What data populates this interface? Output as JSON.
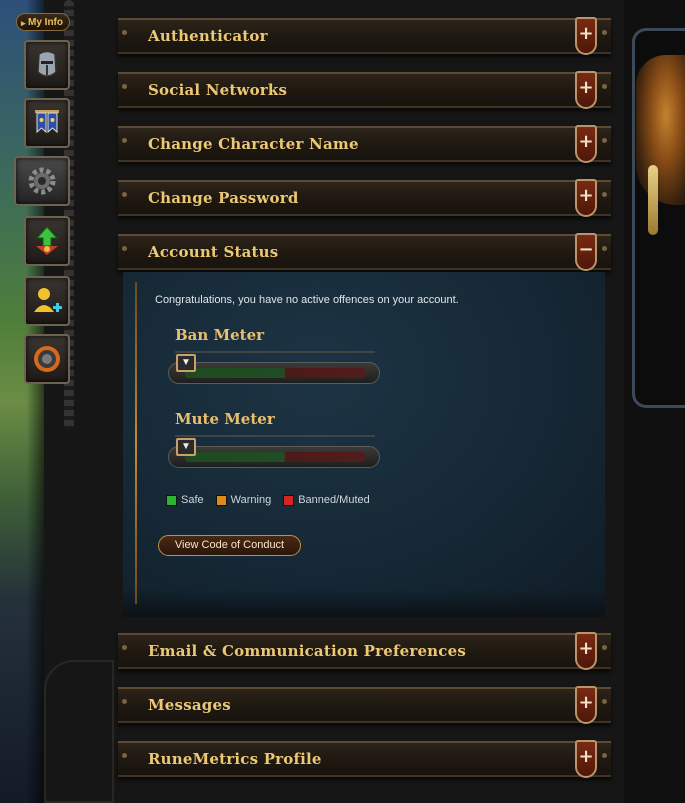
{
  "sidebar": {
    "tab_label": "My Info",
    "buttons": [
      {
        "icon": "helmet-icon"
      },
      {
        "icon": "banner-icon"
      },
      {
        "icon": "gear-icon"
      },
      {
        "icon": "upgrade-icon"
      },
      {
        "icon": "add-user-icon"
      },
      {
        "icon": "bond-icon"
      }
    ]
  },
  "sections": {
    "authenticator": {
      "title": "Authenticator",
      "toggle": "+"
    },
    "social_networks": {
      "title": "Social Networks",
      "toggle": "+"
    },
    "change_character_name": {
      "title": "Change Character Name",
      "toggle": "+"
    },
    "change_password": {
      "title": "Change Password",
      "toggle": "+"
    },
    "account_status": {
      "title": "Account Status",
      "toggle": "−"
    },
    "email_prefs": {
      "title": "Email & Communication Preferences",
      "toggle": "+"
    },
    "messages": {
      "title": "Messages",
      "toggle": "+"
    },
    "runemetrics": {
      "title": "RuneMetrics Profile",
      "toggle": "+"
    }
  },
  "account_status": {
    "message": "Congratulations, you have no active offences on your account.",
    "ban_meter": {
      "title": "Ban Meter",
      "level": 0
    },
    "mute_meter": {
      "title": "Mute Meter",
      "level": 0
    },
    "legend": [
      {
        "label": "Safe",
        "color": "#2db52d"
      },
      {
        "label": "Warning",
        "color": "#e08a1a"
      },
      {
        "label": "Banned/Muted",
        "color": "#d42424"
      }
    ],
    "code_of_conduct_button": "View Code of Conduct"
  }
}
